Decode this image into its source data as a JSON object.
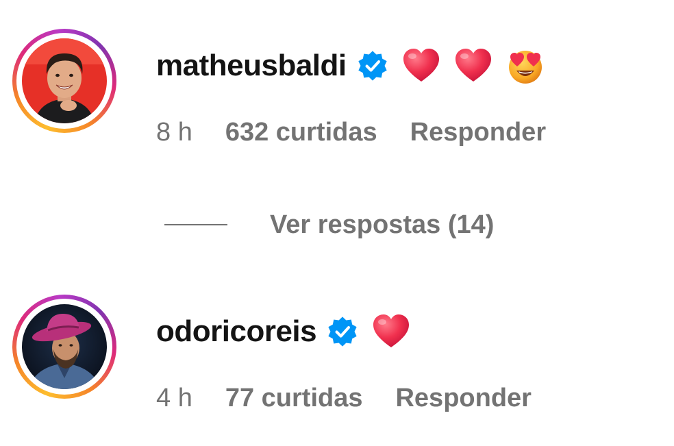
{
  "comments": [
    {
      "username": "matheusbaldi",
      "verified": true,
      "emojis": [
        "heart",
        "heart",
        "star-struck"
      ],
      "time": "8 h",
      "likes": "632 curtidas",
      "reply_label": "Responder"
    },
    {
      "username": "odoricoreis",
      "verified": true,
      "emojis": [
        "heart"
      ],
      "time": "4 h",
      "likes": "77 curtidas",
      "reply_label": "Responder"
    }
  ],
  "view_replies": {
    "label": "Ver respostas (14)"
  },
  "colors": {
    "text_primary": "#141414",
    "text_secondary": "#737373",
    "verified_blue": "#0095f6",
    "heart_red": "#f0304e"
  }
}
